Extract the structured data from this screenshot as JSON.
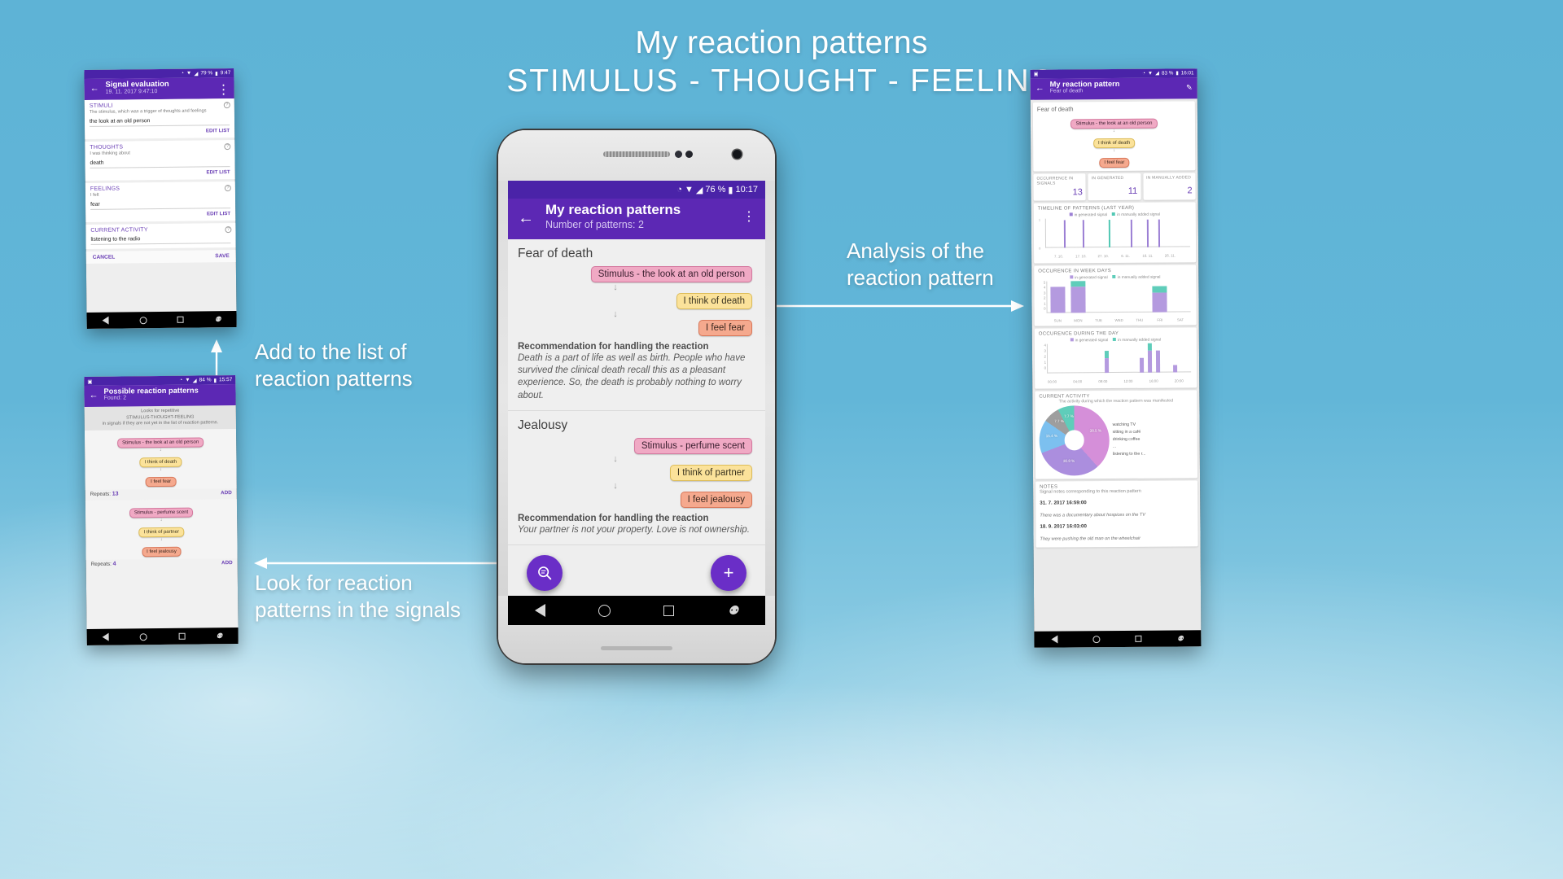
{
  "hero": {
    "line1": "My reaction patterns",
    "line2": "STIMULUS - THOUGHT - FEELING"
  },
  "callouts": {
    "analysis": "Analysis of the\nreaction pattern",
    "analysis_l1": "Analysis of the",
    "analysis_l2": "reaction pattern",
    "add_l1": "Add to the list of",
    "add_l2": "reaction patterns",
    "look_l1": "Look for reaction",
    "look_l2": "patterns in the signals"
  },
  "main_phone": {
    "status": {
      "battery": "76 %",
      "time": "10:17"
    },
    "appbar": {
      "title": "My reaction patterns",
      "subtitle": "Number of patterns: 2",
      "back_icon": "back-arrow-icon",
      "menu_icon": "kebab-menu-icon"
    },
    "patterns": [
      {
        "title": "Fear of death",
        "stimulus": "Stimulus - the look at an old person",
        "thought": "I think of death",
        "feeling": "I feel fear",
        "rec_title": "Recommendation for handling the reaction",
        "rec_text": "Death is a part of life as well as birth. People who have survived the clinical death recall this as a pleasant experience. So, the death is probably nothing to worry about."
      },
      {
        "title": "Jealousy",
        "stimulus": "Stimulus - perfume scent",
        "thought": "I think of partner",
        "feeling": "I feel jealousy",
        "rec_title": "Recommendation for handling the reaction",
        "rec_text": "Your partner is not your property. Love is not ownership."
      }
    ],
    "fab_search": "search-patterns-fab",
    "fab_add": "+"
  },
  "phone1": {
    "status": {
      "battery": "79 %",
      "time": "9:47"
    },
    "appbar": {
      "title": "Signal evaluation",
      "subtitle": "19. 11. 2017   9:47:10"
    },
    "sections": [
      {
        "label": "STIMULI",
        "hint": "The stimulus, which was a trigger of thoughts and feelings",
        "value": "the look at an old person",
        "action": "EDIT LIST"
      },
      {
        "label": "THOUGHTS",
        "hint": "I was thinking about",
        "value": "death",
        "action": "EDIT LIST"
      },
      {
        "label": "FEELINGS",
        "hint": "I felt",
        "value": "fear",
        "action": "EDIT LIST"
      },
      {
        "label": "CURRENT ACTIVITY",
        "hint": "",
        "value": "listening to the radio",
        "action": ""
      }
    ],
    "cancel": "CANCEL",
    "save": "SAVE"
  },
  "phone2": {
    "status": {
      "battery": "84 %",
      "time": "15:57"
    },
    "appbar": {
      "title": "Possible reaction patterns",
      "subtitle": "Found: 2"
    },
    "description": "Looks for repetitive\nSTIMULUS-THOUGHT-FEELING\nin signals if they are not yet in the list of reaction patterns.",
    "description_l1": "Looks for repetitive",
    "description_l2": "STIMULUS-THOUGHT-FEELING",
    "description_l3": "in signals if they are not yet in the list of reaction patterns.",
    "groups": [
      {
        "stimulus": "Stimulus - the look at an old person",
        "thought": "I think of death",
        "feeling": "I feel fear",
        "repeats_label": "Repeats:",
        "repeats": "13",
        "add": "ADD"
      },
      {
        "stimulus": "Stimulus - perfume scent",
        "thought": "I think of partner",
        "feeling": "I feel jealousy",
        "repeats_label": "Repeats:",
        "repeats": "4",
        "add": "ADD"
      }
    ]
  },
  "phone3": {
    "status": {
      "battery": "83 %",
      "time": "16:01"
    },
    "appbar": {
      "title": "My reaction pattern",
      "subtitle": "Fear of death",
      "edit_icon": "pencil-edit-icon"
    },
    "pattern": {
      "title": "Fear of death",
      "stimulus": "Stimulus - the look at an old person",
      "thought": "I think of death",
      "feeling": "I feel fear"
    },
    "stats": [
      {
        "label": "OCCURRENCE IN SIGNALS",
        "value": "13"
      },
      {
        "label": "IN GENERATED",
        "value": "11"
      },
      {
        "label": "IN MANUALLY ADDED",
        "value": "2"
      }
    ],
    "legend": {
      "generated": "in generated signal",
      "manual": "in manually added signal"
    },
    "notes_header": "NOTES",
    "notes_sub": "Signal notes corresponding to this reaction pattern",
    "notes": [
      {
        "date": "31. 7. 2017   16:59:00",
        "text": "There was a documentary about hospices on the TV"
      },
      {
        "date": "18. 9. 2017   16:03:00",
        "text": "They were pushing the old man on the wheelchair"
      }
    ]
  },
  "chart_data": [
    {
      "type": "bar",
      "title": "TIMELINE OF PATTERNS (LAST YEAR)",
      "xlabel": "",
      "ylabel": "",
      "categories": [
        "7. 10.",
        "17. 10.",
        "27. 10.",
        "6. 11.",
        "16. 11.",
        "26. 11."
      ],
      "tick_labels": [
        "7. 10.",
        "17. 10.",
        "27. 10.",
        "6. 11.",
        "16. 11.",
        "26. 11."
      ],
      "ylim": [
        0,
        1
      ],
      "ytick_labels": [
        "0",
        "1"
      ],
      "legend": [
        "in generated signal",
        "in manually added signal"
      ],
      "legend_position": "top",
      "series": [
        {
          "name": "in generated signal",
          "color": "#9b7fd4",
          "points": [
            {
              "x": 0.13,
              "y": 1
            },
            {
              "x": 0.26,
              "y": 1
            },
            {
              "x": 0.59,
              "y": 1
            },
            {
              "x": 0.7,
              "y": 1
            },
            {
              "x": 0.78,
              "y": 1
            }
          ]
        },
        {
          "name": "in manually added signal",
          "color": "#52c8b4",
          "points": [
            {
              "x": 0.44,
              "y": 1
            }
          ]
        }
      ]
    },
    {
      "type": "bar",
      "title": "OCCURENCE IN WEEK DAYS",
      "categories": [
        "SUN",
        "MON",
        "TUE",
        "WED",
        "THU",
        "FRI",
        "SAT"
      ],
      "ylim": [
        0,
        5
      ],
      "ytick_labels": [
        "0",
        "1",
        "2",
        "3",
        "4",
        "5"
      ],
      "legend": [
        "in generated signal",
        "in manually added signal"
      ],
      "legend_position": "top",
      "stacked": true,
      "series": [
        {
          "name": "in generated signal",
          "color": "#b49adf",
          "values": [
            4,
            4,
            0,
            0,
            0,
            3,
            0
          ]
        },
        {
          "name": "in manually added signal",
          "color": "#5fcdba",
          "values": [
            0,
            1,
            0,
            0,
            0,
            1,
            0
          ]
        }
      ]
    },
    {
      "type": "bar",
      "title": "OCCURENCE DURING THE DAY",
      "categories": [
        "00:00",
        "04:00",
        "08:00",
        "12:00",
        "16:00",
        "20:00"
      ],
      "ylim": [
        0,
        4
      ],
      "ytick_labels": [
        "0",
        "1",
        "2",
        "3",
        "4"
      ],
      "legend": [
        "in generated signal",
        "in manually added signal"
      ],
      "legend_position": "top",
      "stacked": true,
      "bars": [
        {
          "x_frac": 0.4,
          "generated": 2,
          "manual": 1
        },
        {
          "x_frac": 0.64,
          "generated": 2,
          "manual": 0
        },
        {
          "x_frac": 0.7,
          "generated": 3,
          "manual": 1
        },
        {
          "x_frac": 0.755,
          "generated": 3,
          "manual": 0
        },
        {
          "x_frac": 0.875,
          "generated": 1,
          "manual": 0
        }
      ]
    },
    {
      "type": "pie",
      "title": "CURRENT ACTIVITY",
      "subtitle": "The activity during which the reaction pattern was manifested",
      "labels": [
        "watching TV",
        "sitting in a café",
        "drinking coffee",
        "...",
        "listening to the r..."
      ],
      "values": [
        38.5,
        30.8,
        15.4,
        7.7,
        7.7
      ],
      "value_labels": [
        "38.5 %",
        "30.8 %",
        "15.4 %",
        "7.7 %",
        "7.7 %"
      ],
      "colors": [
        "#d58fd9",
        "#ab8ede",
        "#7cc0ef",
        "#9e9e9e",
        "#5fcdba"
      ],
      "legend_position": "right",
      "donut": true
    }
  ]
}
